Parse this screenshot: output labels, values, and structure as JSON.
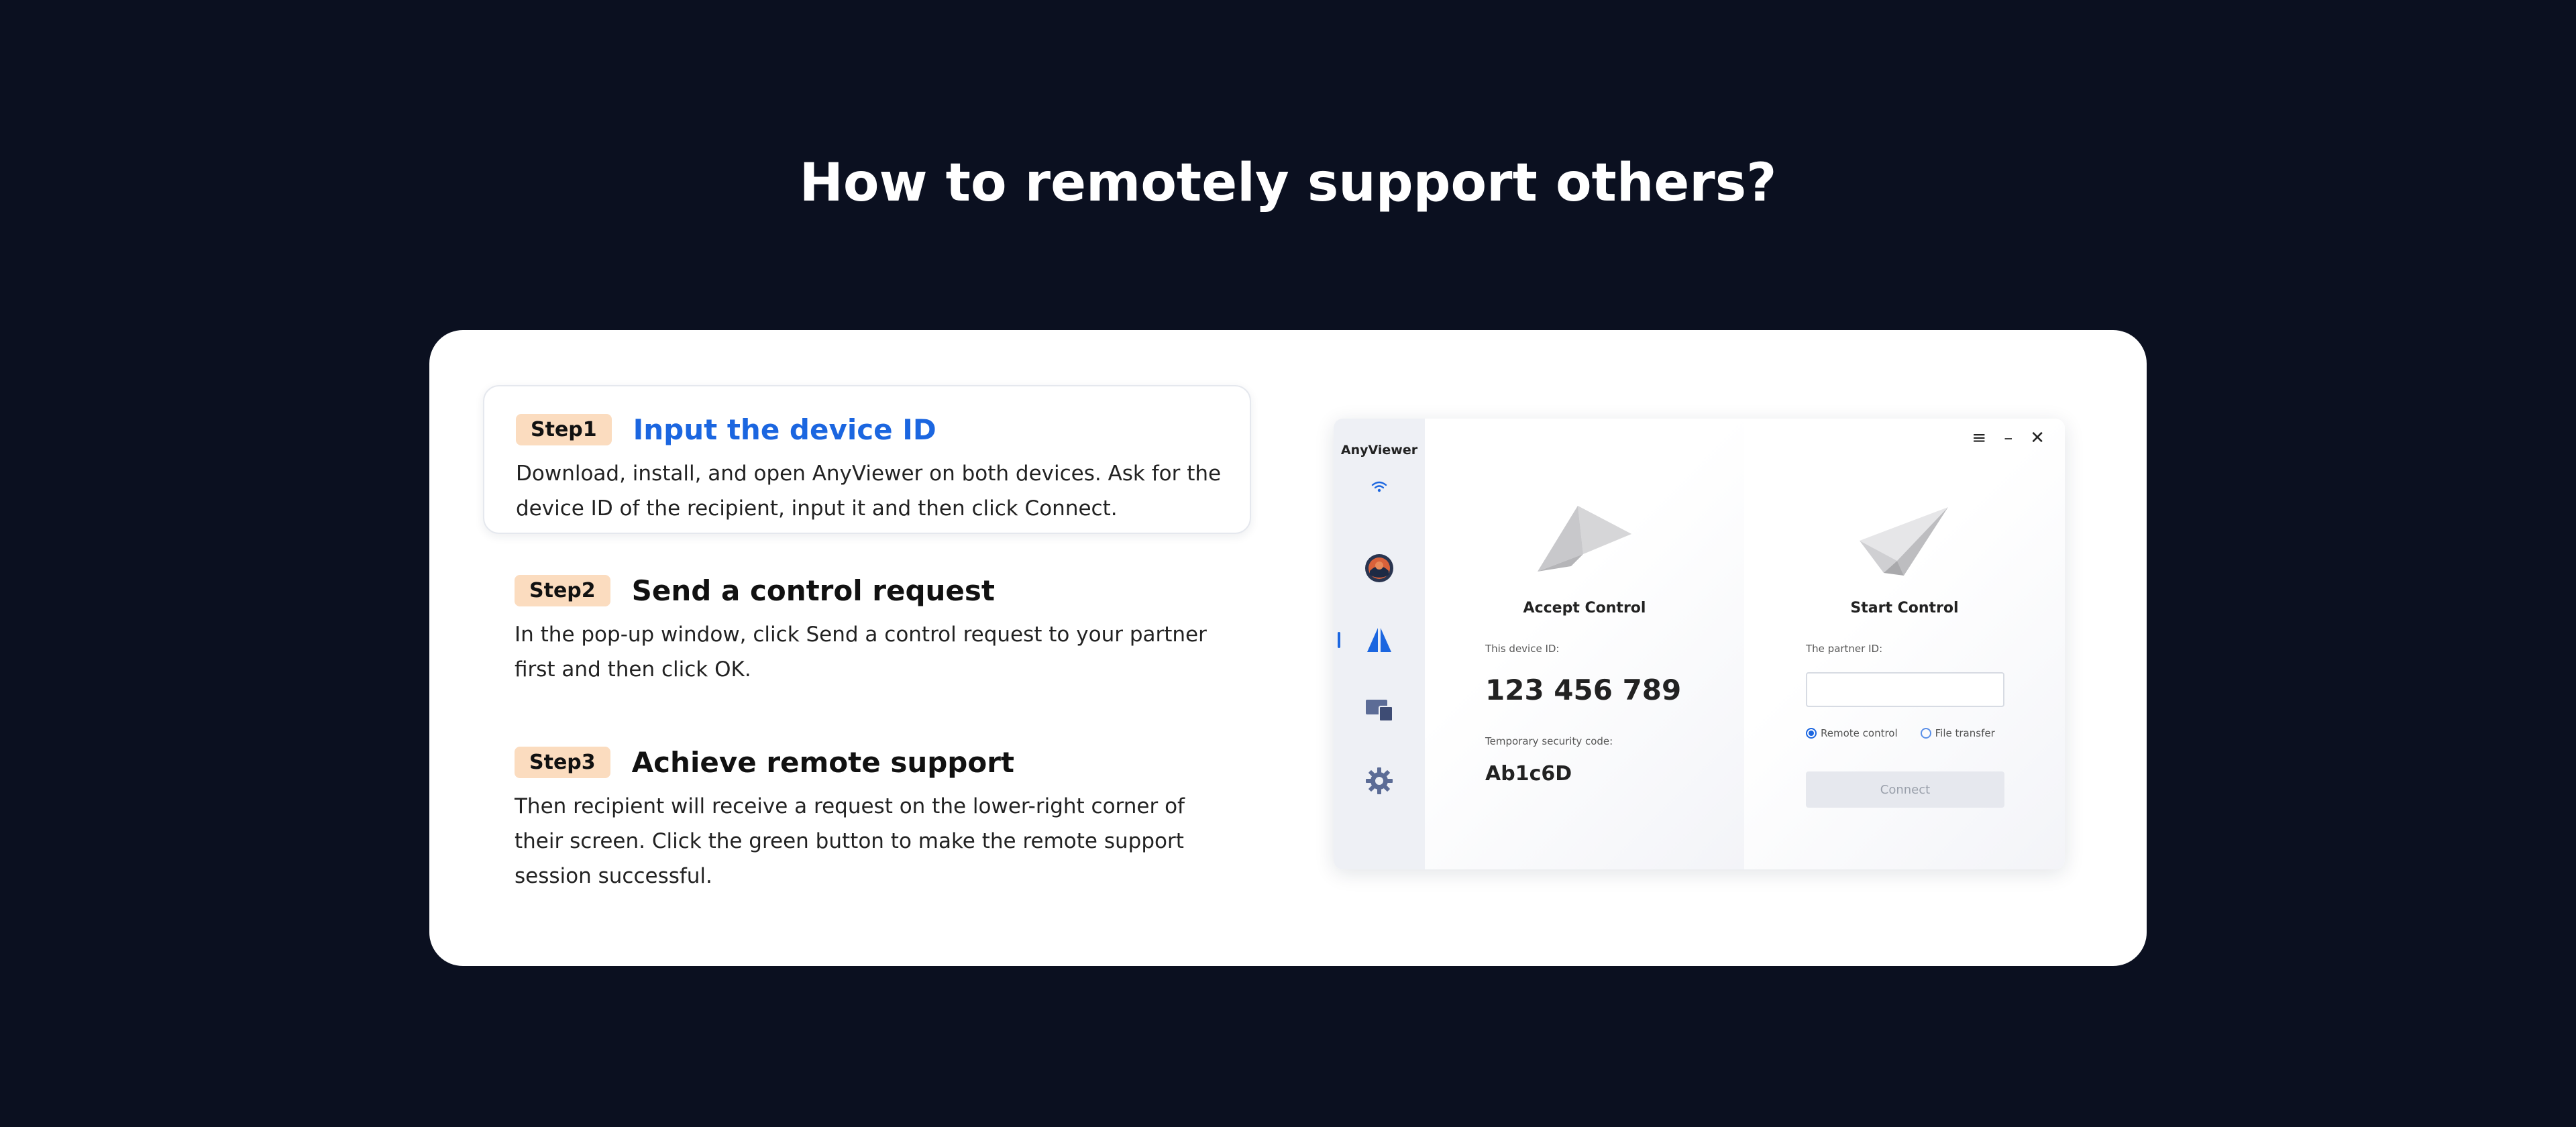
{
  "page": {
    "title": "How to remotely support others?"
  },
  "steps": [
    {
      "badge": "Step1",
      "title": "Input the device ID",
      "description": "Download, install, and open AnyViewer on both devices. Ask for the device ID of the recipient, input it and then click Connect."
    },
    {
      "badge": "Step2",
      "title": "Send a control request",
      "description": "In the pop-up window, click Send a control request to your partner first and then click OK."
    },
    {
      "badge": "Step3",
      "title": "Achieve remote support",
      "description": "Then recipient will receive a request on the lower-right corner of their screen. Click the green button to make the remote support session successful."
    }
  ],
  "app": {
    "name": "AnyViewer",
    "window_controls": [
      "≡",
      "–",
      "✕"
    ],
    "sidebar_icons": [
      "wifi-icon",
      "avatar",
      "control-icon",
      "devices-icon",
      "settings-icon"
    ],
    "accept": {
      "title": "Accept Control",
      "device_id_label": "This device ID:",
      "device_id": "123 456 789",
      "security_label": "Temporary security code:",
      "security_code": "Ab1c6D"
    },
    "start": {
      "title": "Start Control",
      "partner_label": "The partner ID:",
      "partner_value": "",
      "radio_remote": "Remote control",
      "radio_file": "File transfer",
      "connect_label": "Connect"
    }
  },
  "colors": {
    "background": "#0b1020",
    "accent": "#1b66e0",
    "badge": "#fbdcbf"
  }
}
